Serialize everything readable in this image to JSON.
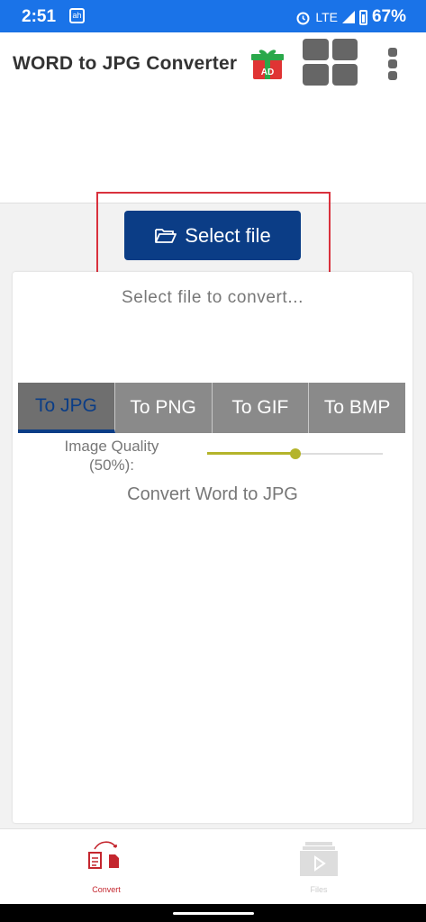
{
  "status_bar": {
    "time": "2:51",
    "notification_icon_text": "ah",
    "network": "LTE",
    "battery_percent": "67%",
    "icons": [
      "alarm-icon",
      "signal-icon",
      "battery-icon"
    ]
  },
  "app_bar": {
    "title": "WORD to JPG Converter",
    "ad_badge": "AD",
    "icons": [
      "gift-ad-icon",
      "grid-apps-icon",
      "more-vert-icon"
    ]
  },
  "main": {
    "select_button_label": "Select file",
    "hint": "Select file to convert...",
    "tabs": [
      {
        "label": "To JPG",
        "active": true
      },
      {
        "label": "To PNG",
        "active": false
      },
      {
        "label": "To GIF",
        "active": false
      },
      {
        "label": "To BMP",
        "active": false
      }
    ],
    "quality_label_line1": "Image Quality",
    "quality_label_line2": "(50%):",
    "quality_value": 0.5,
    "convert_label": "Convert Word to JPG"
  },
  "bottom_nav": {
    "items": [
      {
        "label": "Convert",
        "icon": "convert-icon",
        "active": true
      },
      {
        "label": "Files",
        "icon": "files-icon",
        "active": false
      }
    ]
  },
  "colors": {
    "status_bar": "#1a73e8",
    "primary": "#0b3d86",
    "accent_red": "#d9313d",
    "slider": "#b4b42c"
  }
}
